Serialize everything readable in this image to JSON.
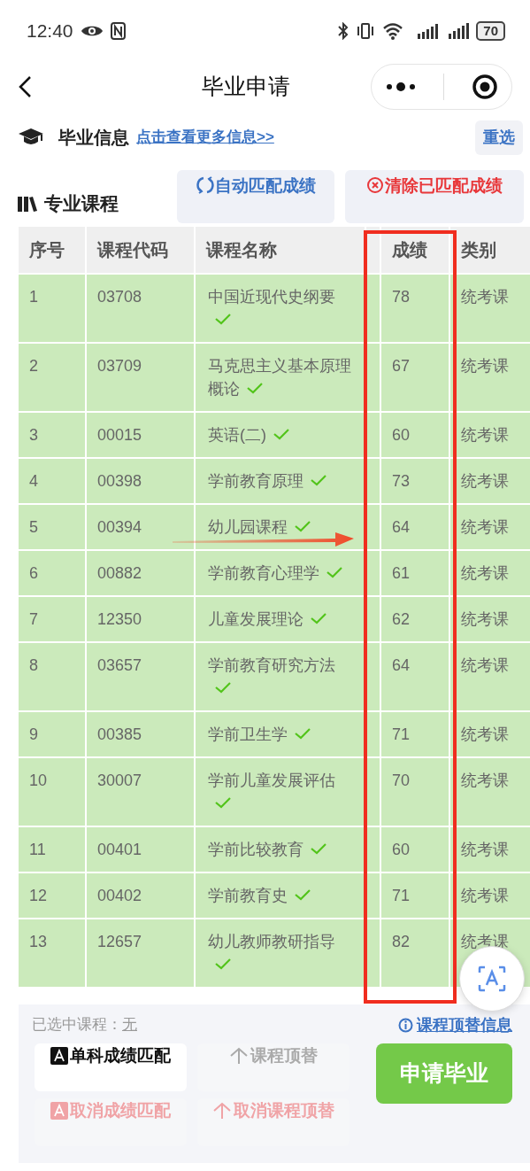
{
  "status_bar": {
    "time": "12:40",
    "battery": "70"
  },
  "nav": {
    "title": "毕业申请"
  },
  "grad_info": {
    "title": "毕业信息",
    "link": "点击查看更多信息>>",
    "reset_button": "重选"
  },
  "courses": {
    "title": "专业课程",
    "actions": [
      {
        "label": "自动匹配成绩",
        "kind": "auto"
      },
      {
        "label": "清除已匹配成绩",
        "kind": "clear"
      }
    ]
  },
  "table": {
    "columns": [
      "序号",
      "课程代码",
      "课程名称",
      "成绩",
      "类别"
    ],
    "rows": [
      {
        "no": "1",
        "code": "03708",
        "name": "中国近现代史纲要",
        "matched": true,
        "score": "78",
        "category": "统考课"
      },
      {
        "no": "2",
        "code": "03709",
        "name": "马克思主义基本原理概论",
        "matched": true,
        "score": "67",
        "category": "统考课"
      },
      {
        "no": "3",
        "code": "00015",
        "name": "英语(二)",
        "matched": true,
        "score": "60",
        "category": "统考课"
      },
      {
        "no": "4",
        "code": "00398",
        "name": "学前教育原理",
        "matched": true,
        "score": "73",
        "category": "统考课"
      },
      {
        "no": "5",
        "code": "00394",
        "name": "幼儿园课程",
        "matched": true,
        "score": "64",
        "category": "统考课"
      },
      {
        "no": "6",
        "code": "00882",
        "name": "学前教育心理学",
        "matched": true,
        "score": "61",
        "category": "统考课"
      },
      {
        "no": "7",
        "code": "12350",
        "name": "儿童发展理论",
        "matched": true,
        "score": "62",
        "category": "统考课"
      },
      {
        "no": "8",
        "code": "03657",
        "name": "学前教育研究方法",
        "matched": true,
        "score": "64",
        "category": "统考课"
      },
      {
        "no": "9",
        "code": "00385",
        "name": "学前卫生学",
        "matched": true,
        "score": "71",
        "category": "统考课"
      },
      {
        "no": "10",
        "code": "30007",
        "name": "学前儿童发展评估",
        "matched": true,
        "score": "70",
        "category": "统考课"
      },
      {
        "no": "11",
        "code": "00401",
        "name": "学前比较教育",
        "matched": true,
        "score": "60",
        "category": "统考课"
      },
      {
        "no": "12",
        "code": "00402",
        "name": "学前教育史",
        "matched": true,
        "score": "71",
        "category": "统考课"
      },
      {
        "no": "13",
        "code": "12657",
        "name": "幼儿教师教研指导",
        "matched": true,
        "score": "82",
        "category": "统考课"
      }
    ]
  },
  "footer": {
    "selected_label": "已选中课程：",
    "selected_value": "无",
    "info_link": "课程顶替信息",
    "actions": [
      {
        "label": "单科成绩匹配",
        "kind": "match",
        "disabled": false
      },
      {
        "label": "课程顶替",
        "kind": "substitute",
        "disabled": true
      },
      {
        "label": "取消成绩匹配",
        "kind": "match",
        "disabled": true
      },
      {
        "label": "取消课程顶替",
        "kind": "substitute",
        "disabled": true
      }
    ],
    "submit": "申请毕业"
  }
}
